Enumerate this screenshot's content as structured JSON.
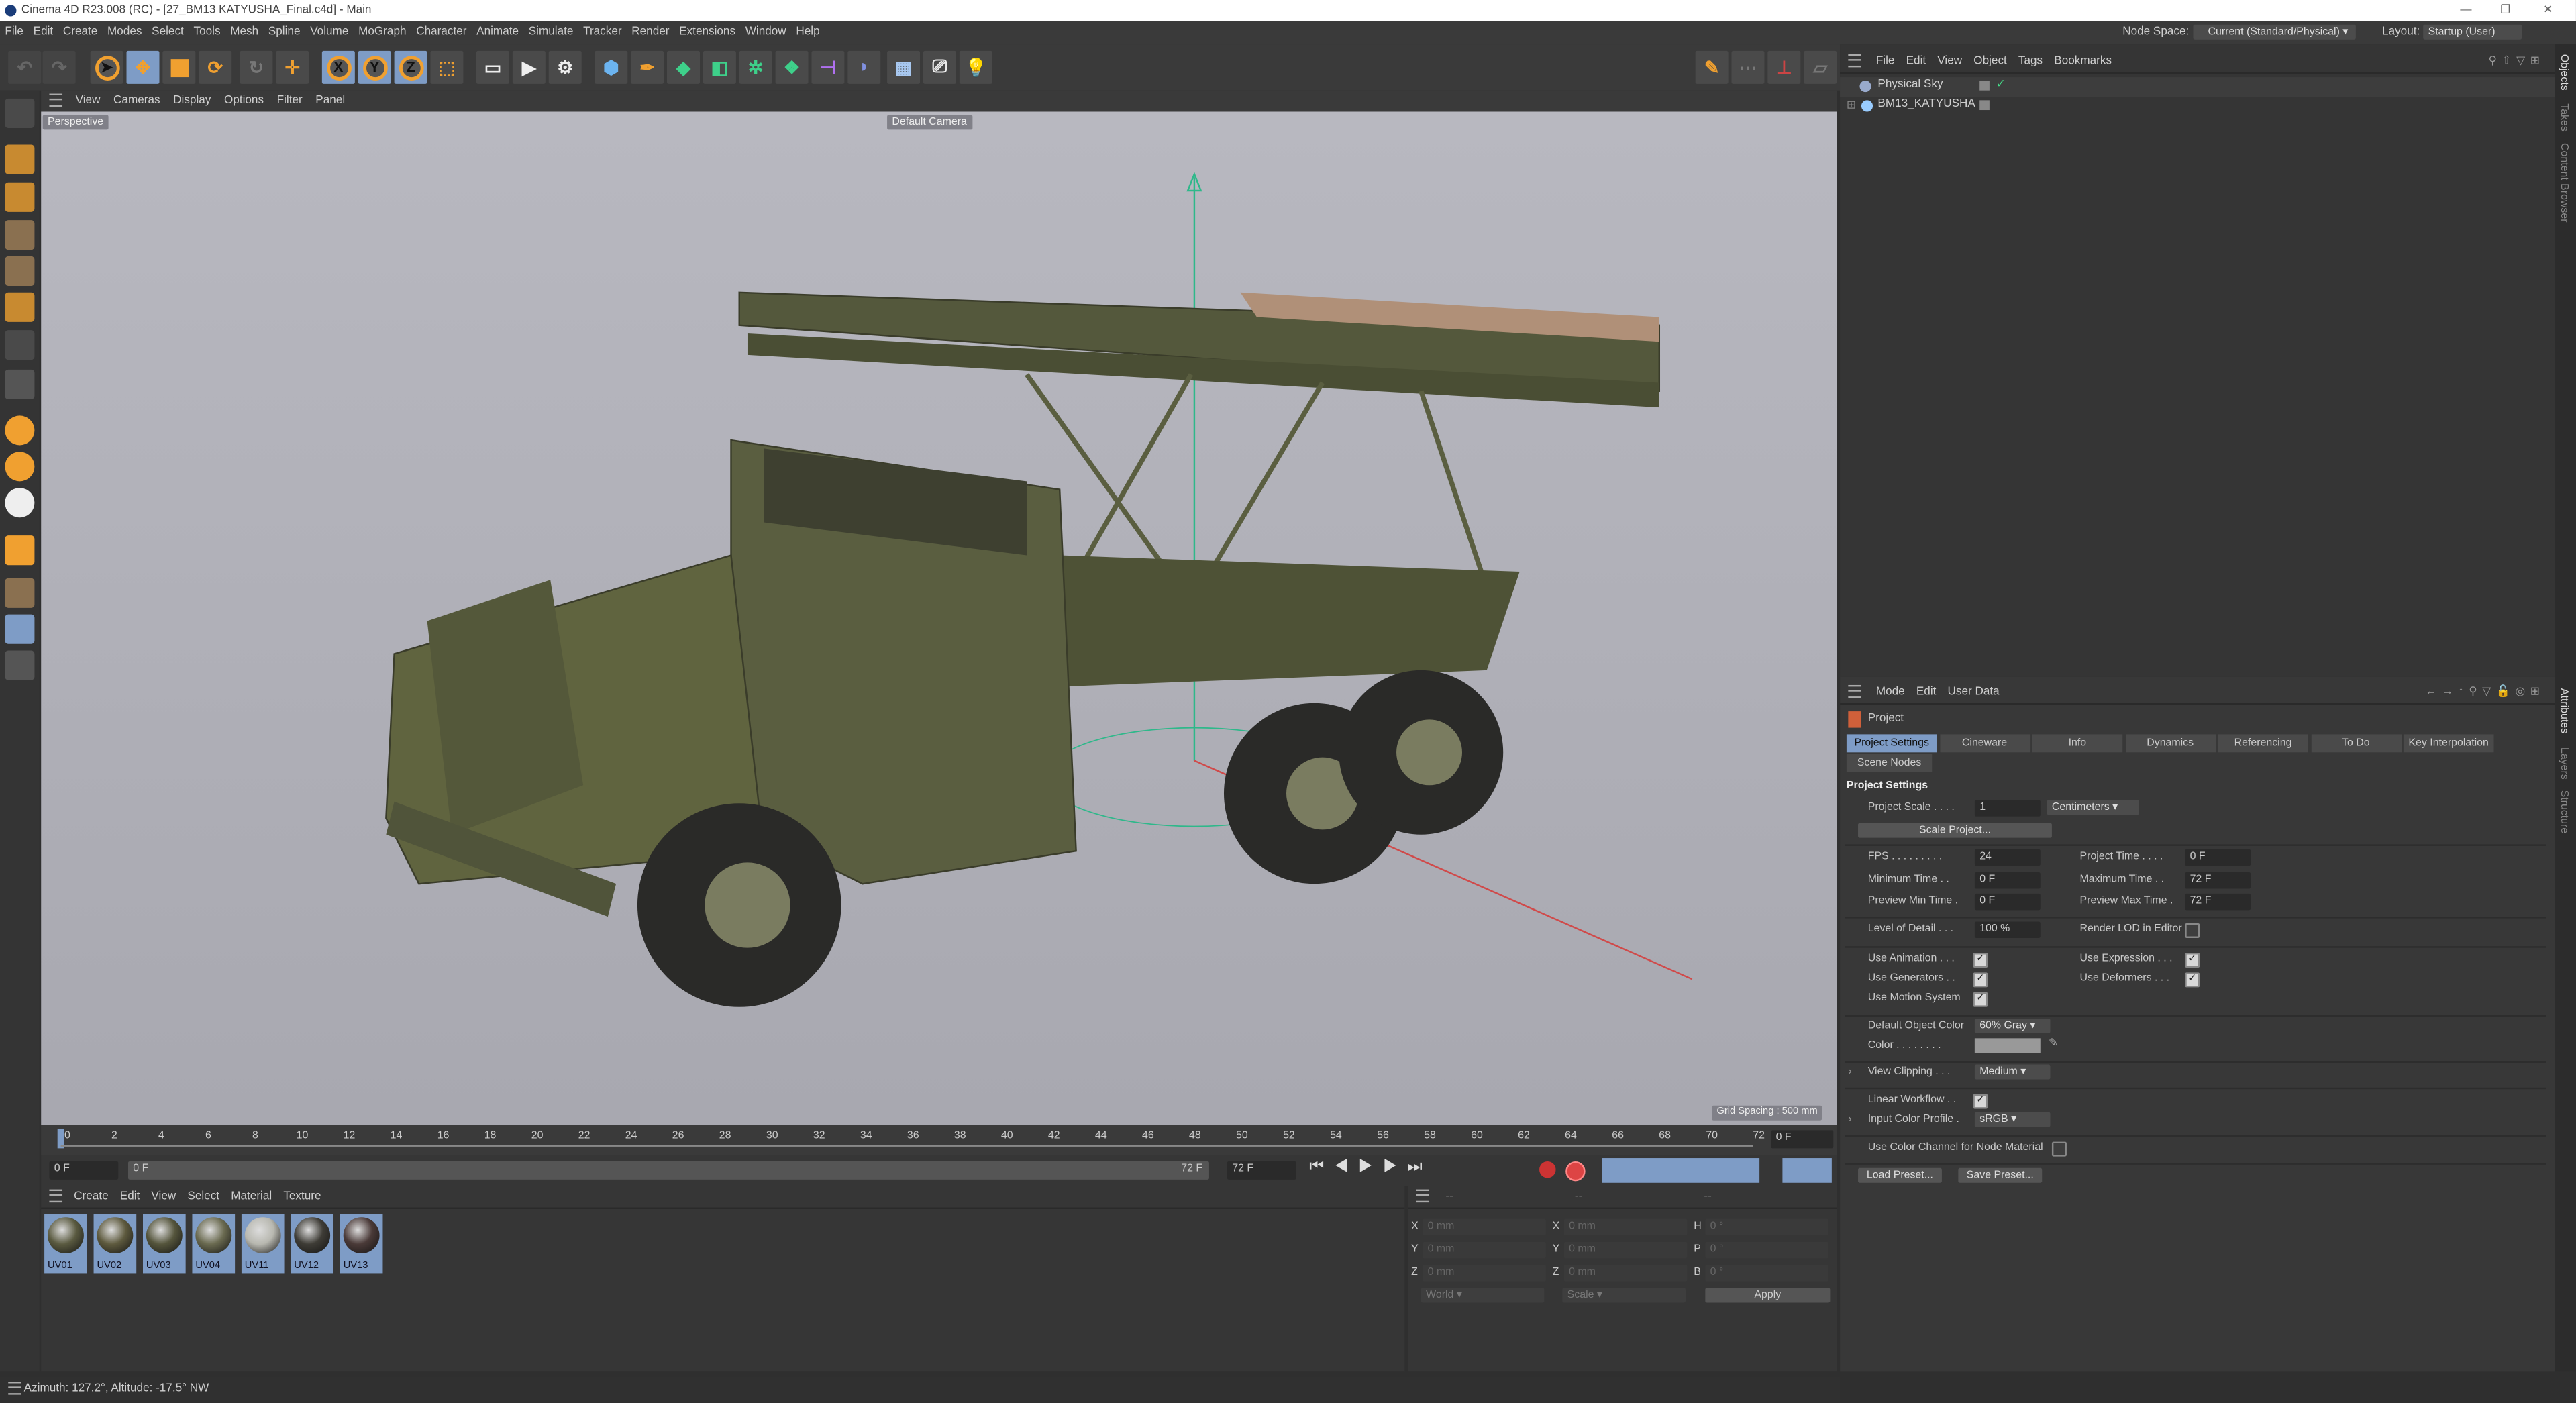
{
  "window": {
    "title": "Cinema 4D R23.008 (RC) - [27_BM13 KATYUSHA_Final.c4d] - Main",
    "controls": [
      "—",
      "❐",
      "✕"
    ]
  },
  "menu": [
    "File",
    "Edit",
    "Create",
    "Modes",
    "Select",
    "Tools",
    "Mesh",
    "Spline",
    "Volume",
    "MoGraph",
    "Character",
    "Animate",
    "Simulate",
    "Tracker",
    "Render",
    "Extensions",
    "Window",
    "Help"
  ],
  "topright": {
    "node_space_label": "Node Space:",
    "node_space_value": "Current (Standard/Physical)",
    "layout_label": "Layout:",
    "layout_value": "Startup (User)"
  },
  "toolbar": {
    "x": "X",
    "y": "Y",
    "z": "Z"
  },
  "viewport": {
    "menu": [
      "View",
      "Cameras",
      "Display",
      "Options",
      "Filter",
      "Panel"
    ],
    "view_name": "Perspective",
    "camera": "Default Camera",
    "grid_spacing": "Grid Spacing : 500 mm"
  },
  "timeline": {
    "ticks": [
      "0",
      "2",
      "4",
      "6",
      "8",
      "10",
      "12",
      "14",
      "16",
      "18",
      "20",
      "22",
      "24",
      "26",
      "28",
      "30",
      "32",
      "34",
      "36",
      "38",
      "40",
      "42",
      "44",
      "46",
      "48",
      "50",
      "52",
      "54",
      "56",
      "58",
      "60",
      "62",
      "64",
      "66",
      "68",
      "70",
      "72"
    ],
    "current_frame": "0 F",
    "start": "0 F",
    "range_start": "0 F",
    "range_end": "72 F",
    "end": "72 F",
    "progress": 0
  },
  "materials": {
    "menu": [
      "Create",
      "Edit",
      "View",
      "Select",
      "Material",
      "Texture"
    ],
    "items": [
      {
        "name": "UV01",
        "color": "#5a5a40"
      },
      {
        "name": "UV02",
        "color": "#5e5a3e"
      },
      {
        "name": "UV03",
        "color": "#55553c"
      },
      {
        "name": "UV04",
        "color": "#6a6a50"
      },
      {
        "name": "UV11",
        "color": "#b8b8b0"
      },
      {
        "name": "UV12",
        "color": "#3e3c36"
      },
      {
        "name": "UV13",
        "color": "#4a3a38"
      }
    ]
  },
  "coords": {
    "header": [
      "--",
      "--",
      "--"
    ],
    "rows": [
      {
        "a": "X",
        "av": "0 mm",
        "b": "X",
        "bv": "0 mm",
        "c": "H",
        "cv": "0 °"
      },
      {
        "a": "Y",
        "av": "0 mm",
        "b": "Y",
        "bv": "0 mm",
        "c": "P",
        "cv": "0 °"
      },
      {
        "a": "Z",
        "av": "0 mm",
        "b": "Z",
        "bv": "0 mm",
        "c": "B",
        "cv": "0 °"
      }
    ],
    "world": "World",
    "scale": "Scale",
    "apply": "Apply"
  },
  "status": "Azimuth: 127.2°, Altitude: -17.5°  NW",
  "objects": {
    "menu": [
      "File",
      "Edit",
      "View",
      "Object",
      "Tags",
      "Bookmarks"
    ],
    "items": [
      {
        "name": "Physical Sky",
        "check": "✓"
      },
      {
        "name": "BM13_KATYUSHA",
        "check": ""
      }
    ]
  },
  "side_tabs": [
    "Objects",
    "Takes",
    "Content Browser",
    "Attributes",
    "Layers",
    "Structure"
  ],
  "attributes": {
    "menu": [
      "Mode",
      "Edit",
      "User Data"
    ],
    "object": "Project",
    "tabs": [
      "Project Settings",
      "Cineware",
      "Info",
      "Dynamics",
      "Referencing",
      "To Do",
      "Key Interpolation"
    ],
    "tab2": "Scene Nodes",
    "section": "Project Settings",
    "project_scale_label": "Project Scale . . . .",
    "project_scale": "1",
    "unit": "Centimeters",
    "scale_project": "Scale Project...",
    "fps_label": "FPS . . . . . . . . .",
    "fps": "24",
    "project_time_label": "Project Time . . . .",
    "project_time": "0 F",
    "min_time_label": "Minimum Time . .",
    "min_time": "0 F",
    "max_time_label": "Maximum Time . .",
    "max_time": "72 F",
    "prev_min_label": "Preview Min Time .",
    "prev_min": "0 F",
    "prev_max_label": "Preview Max Time .",
    "prev_max": "72 F",
    "lod_label": "Level of Detail . . .",
    "lod": "100 %",
    "render_lod_label": "Render LOD in Editor",
    "use_anim": "Use Animation . . .",
    "use_gen": "Use Generators . .",
    "use_motion": "Use Motion System",
    "use_expr": "Use Expression . . .",
    "use_def": "Use Deformers . . .",
    "def_color_label": "Default Object Color",
    "def_color": "60% Gray",
    "color_label": "Color . . . . . . . .",
    "view_clip_label": "View Clipping . . .",
    "view_clip": "Medium",
    "linear_label": "Linear Workflow . .",
    "icp_label": "Input Color Profile .",
    "icp": "sRGB",
    "node_mat_label": "Use Color Channel for Node Material",
    "load": "Load Preset...",
    "save": "Save Preset...",
    "check": "✓"
  },
  "colors": {
    "accent": "#7e9cc6",
    "orange": "#f0a030",
    "bg": "#3a3a3a"
  }
}
